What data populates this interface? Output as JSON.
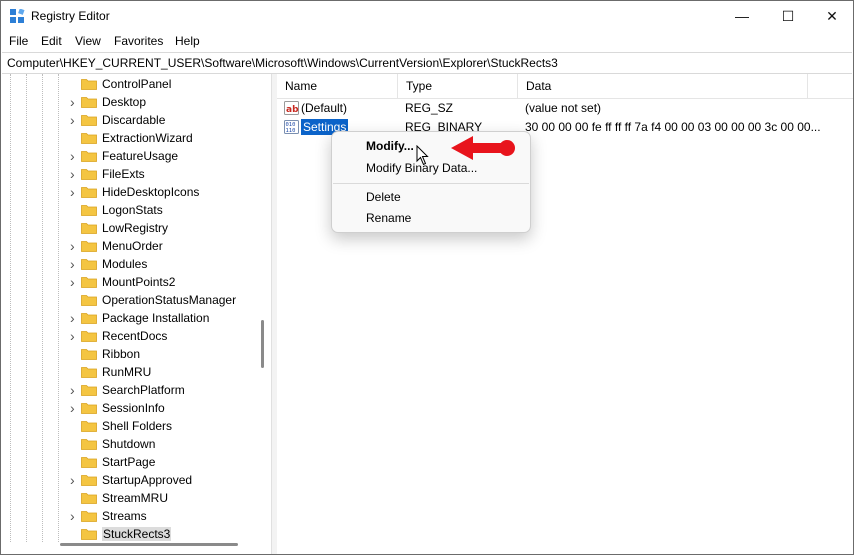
{
  "window": {
    "title": "Registry Editor"
  },
  "title_buttons": {
    "minimize": "—",
    "maximize": "☐",
    "close": "✕"
  },
  "menu": [
    "File",
    "Edit",
    "View",
    "Favorites",
    "Help"
  ],
  "address": "Computer\\HKEY_CURRENT_USER\\Software\\Microsoft\\Windows\\CurrentVersion\\Explorer\\StuckRects3",
  "tree": {
    "items": [
      {
        "label": "ControlPanel",
        "expandable": false
      },
      {
        "label": "Desktop",
        "expandable": true
      },
      {
        "label": "Discardable",
        "expandable": true
      },
      {
        "label": "ExtractionWizard",
        "expandable": false
      },
      {
        "label": "FeatureUsage",
        "expandable": true
      },
      {
        "label": "FileExts",
        "expandable": true
      },
      {
        "label": "HideDesktopIcons",
        "expandable": true
      },
      {
        "label": "LogonStats",
        "expandable": false
      },
      {
        "label": "LowRegistry",
        "expandable": false
      },
      {
        "label": "MenuOrder",
        "expandable": true
      },
      {
        "label": "Modules",
        "expandable": true
      },
      {
        "label": "MountPoints2",
        "expandable": true
      },
      {
        "label": "OperationStatusManager",
        "expandable": false
      },
      {
        "label": "Package Installation",
        "expandable": true
      },
      {
        "label": "RecentDocs",
        "expandable": true
      },
      {
        "label": "Ribbon",
        "expandable": false
      },
      {
        "label": "RunMRU",
        "expandable": false
      },
      {
        "label": "SearchPlatform",
        "expandable": true
      },
      {
        "label": "SessionInfo",
        "expandable": true
      },
      {
        "label": "Shell Folders",
        "expandable": false
      },
      {
        "label": "Shutdown",
        "expandable": false
      },
      {
        "label": "StartPage",
        "expandable": false
      },
      {
        "label": "StartupApproved",
        "expandable": true
      },
      {
        "label": "StreamMRU",
        "expandable": false
      },
      {
        "label": "Streams",
        "expandable": true
      },
      {
        "label": "StuckRects3",
        "expandable": false,
        "selected": true
      }
    ]
  },
  "list": {
    "columns": {
      "name": "Name",
      "type": "Type",
      "data": "Data"
    },
    "rows": [
      {
        "name": "(Default)",
        "type": "REG_SZ",
        "data": "(value not set)",
        "icon": "string-value-icon"
      },
      {
        "name": "Settings",
        "type": "REG_BINARY",
        "data": "30 00 00 00 fe ff ff ff 7a f4 00 00 03 00 00 00 3c 00 00...",
        "icon": "binary-value-icon",
        "selected": true
      }
    ]
  },
  "context_menu": {
    "modify": "Modify...",
    "modify_binary": "Modify Binary Data...",
    "delete": "Delete",
    "rename": "Rename"
  },
  "colors": {
    "selection_blue": "#0b63c9",
    "annotation_red": "#e8141c",
    "folder_yellow": "#f4c542"
  }
}
